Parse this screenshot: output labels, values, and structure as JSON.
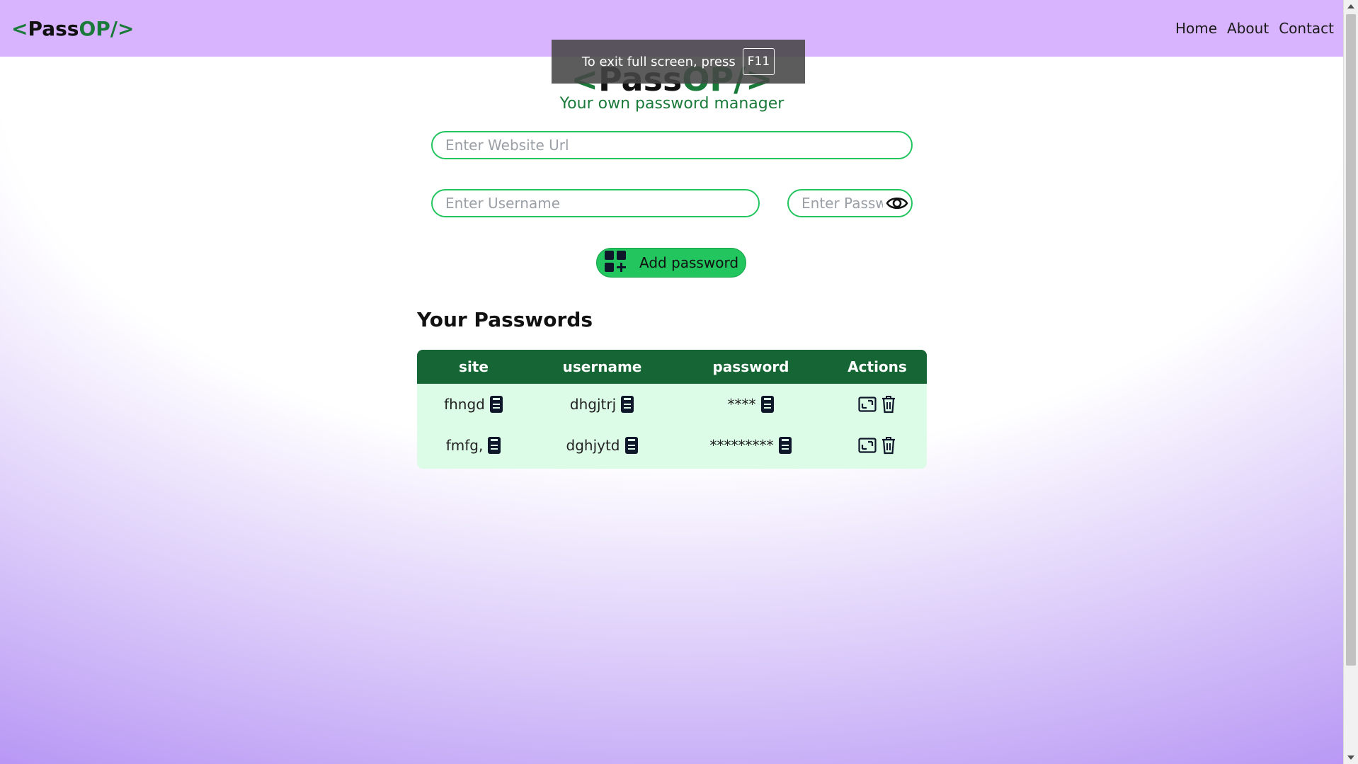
{
  "navbar": {
    "logo": {
      "open": "<",
      "pass": "Pass",
      "op": "OP/>"
    },
    "links": [
      "Home",
      "About",
      "Contact"
    ]
  },
  "fullscreen_notice": {
    "text": "To exit full screen, press",
    "key": "F11"
  },
  "hero": {
    "logo": {
      "open": "<",
      "pass": "Pass",
      "op": "OP/>"
    },
    "tagline": "Your own password manager"
  },
  "form": {
    "url_placeholder": "Enter Website Url",
    "username_placeholder": "Enter Username",
    "password_placeholder": "Enter Password",
    "add_button_label": "Add password"
  },
  "passwords": {
    "title": "Your Passwords",
    "headers": [
      "site",
      "username",
      "password",
      "Actions"
    ],
    "rows": [
      {
        "site": "fhngd",
        "username": "dhgjtrj",
        "password": "****"
      },
      {
        "site": "fmfg,",
        "username": "dghjytd",
        "password": "*********"
      }
    ]
  },
  "colors": {
    "navbar": "#d8b4fe",
    "accent_green": "#22c55e",
    "table_header": "#166534",
    "table_body": "#dcfce7"
  }
}
